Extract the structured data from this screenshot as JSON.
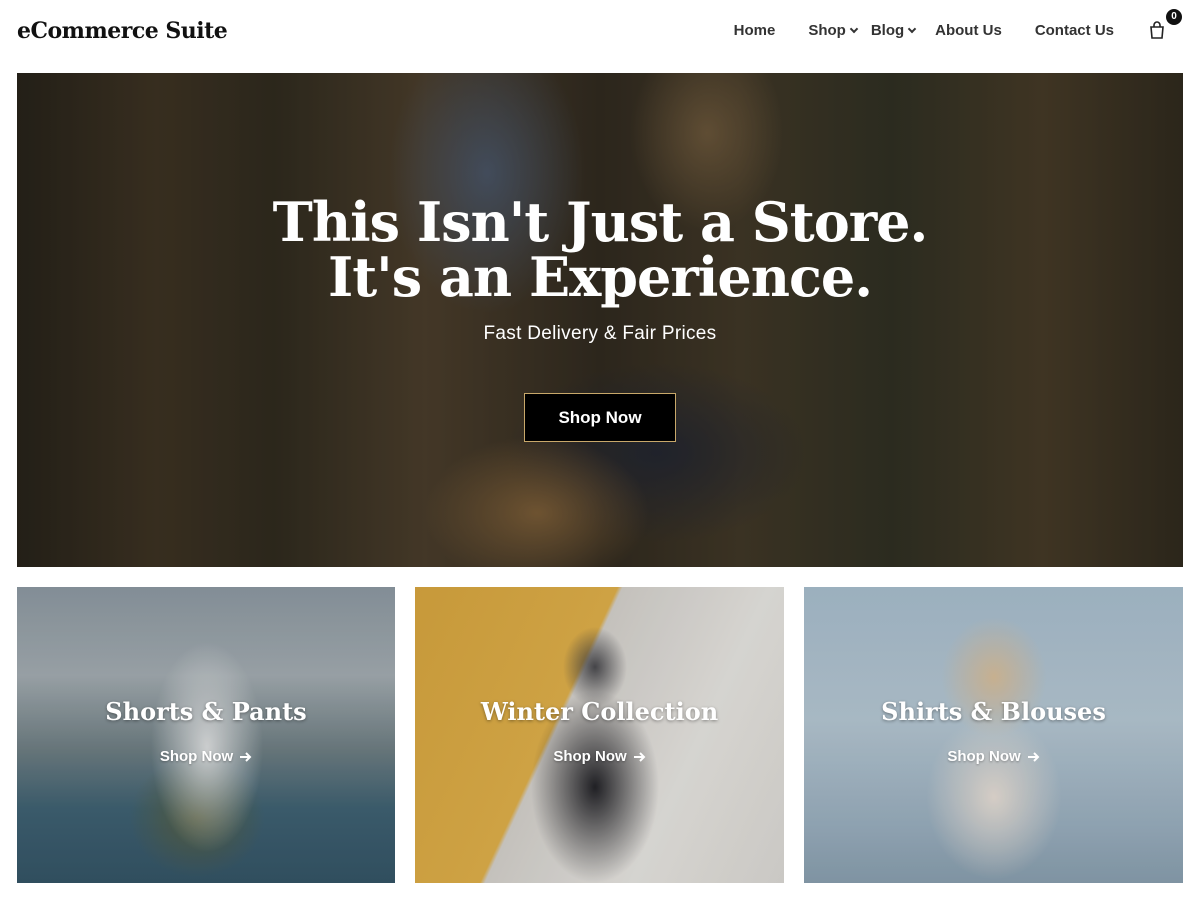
{
  "header": {
    "logo": "eCommerce Suite",
    "nav": {
      "home": "Home",
      "shop": "Shop",
      "blog": "Blog",
      "about": "About Us",
      "contact": "Contact Us"
    },
    "cart_count": "0"
  },
  "hero": {
    "title_line1": "This Isn't Just a Store.",
    "title_line2": "It's an Experience.",
    "subtitle": "Fast Delivery & Fair Prices",
    "button_label": "Shop Now"
  },
  "categories": [
    {
      "title": "Shorts & Pants",
      "link_label": "Shop Now"
    },
    {
      "title": "Winter Collection",
      "link_label": "Shop Now"
    },
    {
      "title": "Shirts & Blouses",
      "link_label": "Shop Now"
    }
  ],
  "colors": {
    "button_bg": "#000000",
    "button_border": "#c8a86a",
    "text_dark": "#111111"
  }
}
